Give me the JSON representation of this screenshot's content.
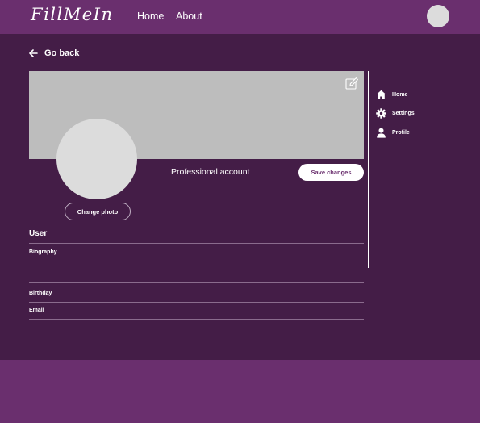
{
  "header": {
    "brand": "FillMeIn",
    "nav": [
      {
        "label": "Home"
      },
      {
        "label": "About"
      }
    ],
    "icons": {
      "avatar": "user-avatar"
    }
  },
  "main": {
    "go_back_label": "Go back",
    "account_type": "Professional account",
    "save_label": "Save changes",
    "change_photo_label": "Change photo",
    "section_title": "User",
    "fields": {
      "biography": {
        "label": "Biography",
        "value": ""
      },
      "birthday": {
        "label": "Birthday",
        "value": ""
      },
      "email": {
        "label": "Email",
        "value": ""
      }
    },
    "icons": {
      "back": "arrow-left-icon",
      "edit": "edit-icon"
    }
  },
  "sidebar": {
    "items": [
      {
        "label": "Home",
        "icon": "home-icon"
      },
      {
        "label": "Settings",
        "icon": "gear-icon"
      },
      {
        "label": "Profile",
        "icon": "user-icon"
      }
    ]
  },
  "colors": {
    "header_bg": "#6a2f6e",
    "main_bg": "#441d47",
    "banner": "#bdbdbd",
    "avatar": "#dcdcdc",
    "button_bg": "#ffffff",
    "button_text": "#6a2f6e"
  }
}
